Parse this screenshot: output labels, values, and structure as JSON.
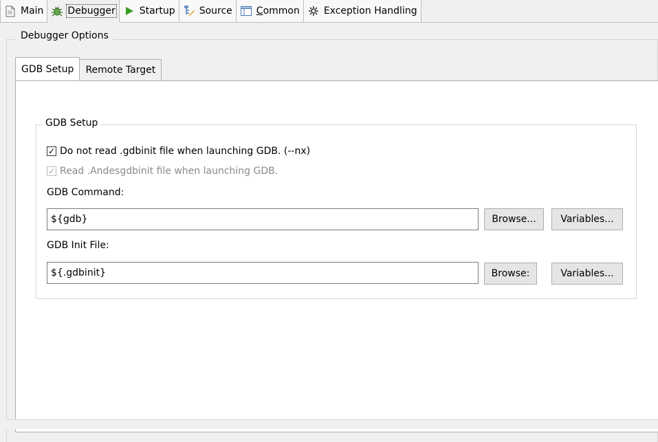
{
  "top_tabs": [
    {
      "label": "Main",
      "icon": "document-icon"
    },
    {
      "label": "Debugger",
      "icon": "bug-icon",
      "active": true
    },
    {
      "label": "Startup",
      "icon": "play-icon"
    },
    {
      "label": "Source",
      "icon": "source-icon"
    },
    {
      "label": "Common",
      "icon": "table-icon",
      "mnemonic": "C"
    },
    {
      "label": "Exception Handling",
      "icon": "gear-icon"
    }
  ],
  "debugger_options": {
    "title": "Debugger Options",
    "tabs": [
      {
        "label": "GDB Setup",
        "active": true
      },
      {
        "label": "Remote Target",
        "active": false
      }
    ]
  },
  "gdb_setup": {
    "group_title": "GDB Setup",
    "nx_checkbox": {
      "label": "Do not read .gdbinit file when launching GDB. (--nx)",
      "checked": true
    },
    "andes_checkbox": {
      "label": "Read .Andesgdbinit file when launching GDB.",
      "checked": true,
      "enabled": false
    },
    "command_label": "GDB Command:",
    "command_value": "${gdb}",
    "command_browse": "Browse...",
    "command_variables": "Variables...",
    "init_label": "GDB Init File:",
    "init_value": "${.gdbinit}",
    "init_browse": "Browse:",
    "init_variables": "Variables..."
  },
  "colors": {
    "background": "#f0f0f0",
    "panel": "#ffffff",
    "play_green": "#3a9d23"
  }
}
